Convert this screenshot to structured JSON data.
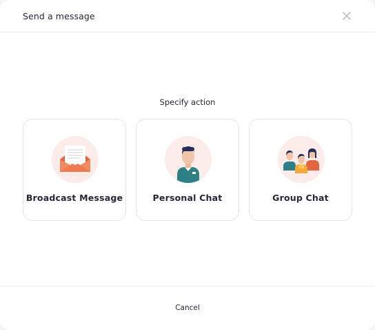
{
  "header": {
    "title": "Send a message",
    "close_icon": "close-icon"
  },
  "main": {
    "prompt": "Specify action",
    "options": [
      {
        "label": "Broadcast Message",
        "icon": "envelope-icon"
      },
      {
        "label": "Personal Chat",
        "icon": "person-icon"
      },
      {
        "label": "Group Chat",
        "icon": "group-icon"
      }
    ]
  },
  "footer": {
    "cancel_label": "Cancel"
  },
  "colors": {
    "accent": "#ee7a4f",
    "icon_background": "#fcece9",
    "text": "#24263a",
    "border": "#e4e4e8"
  }
}
